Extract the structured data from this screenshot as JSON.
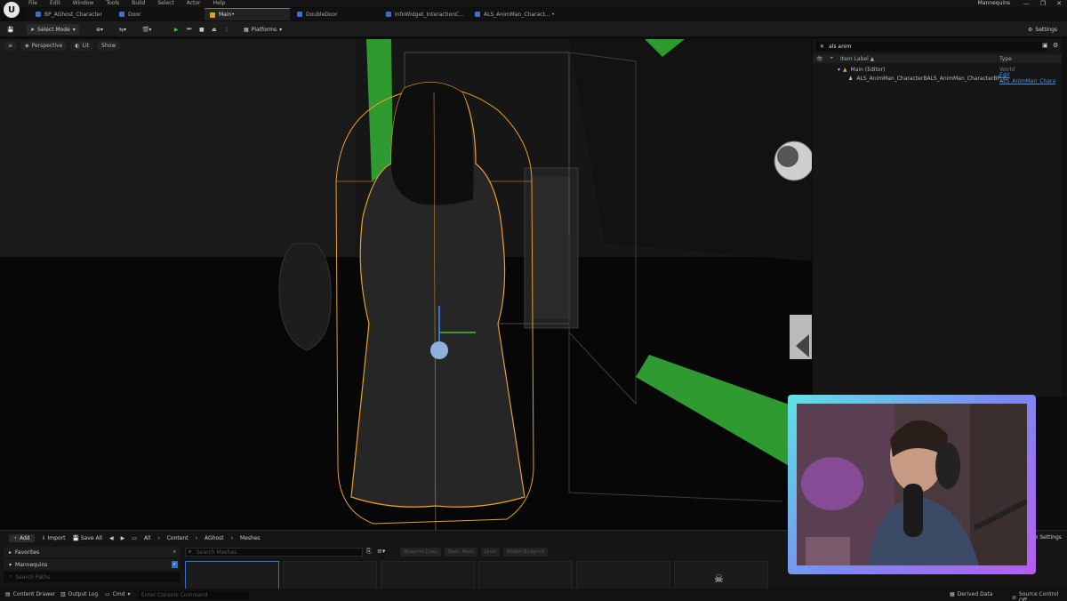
{
  "menu": {
    "items": [
      "File",
      "Edit",
      "Window",
      "Tools",
      "Build",
      "Select",
      "Actor",
      "Help"
    ],
    "project": "Mannequins"
  },
  "tabs": [
    {
      "label": "BP_AGhost_Character"
    },
    {
      "label": "Door"
    },
    {
      "label": "Main•"
    },
    {
      "label": "DoubleDoor"
    },
    {
      "label": "InfoWidget_InteractionC..."
    },
    {
      "label": "ALS_AnimMan_Charact... •"
    }
  ],
  "toolbar": {
    "select_mode": "Select Mode",
    "platforms": "Platforms",
    "settings": "Settings"
  },
  "viewport": {
    "perspective": "Perspective",
    "lit": "Lit",
    "show": "Show"
  },
  "outliner": {
    "search_value": "als anim",
    "col_label": "Item Label ▲",
    "col_type": "Type",
    "rows": [
      {
        "label": "Main (Editor)",
        "type": "World"
      },
      {
        "label": "ALS_AnimMan_CharacterBALS_AnimMan_CharacterBP_C",
        "type": "Edit ALS_AnimMan_Chara"
      }
    ]
  },
  "content_browser": {
    "add": "Add",
    "import": "Import",
    "save_all": "Save All",
    "breadcrumb": [
      "All",
      "Content",
      "AGhost",
      "Meshes"
    ],
    "settings": "Settings",
    "favorites": "Favorites",
    "mannequins": "Mannequins",
    "search_paths_placeholder": "Search Paths",
    "search_meshes_placeholder": "Search Meshes",
    "filters": [
      "Blueprint Class",
      "Static Mesh",
      "Level",
      "Widget Blueprint"
    ]
  },
  "statusbar": {
    "content_drawer": "Content Drawer",
    "output_log": "Output Log",
    "cmd": "Cmd",
    "console_placeholder": "Enter Console Command",
    "derived_data": "Derived Data",
    "source_control": "Source Control Off"
  },
  "colors": {
    "accent_green": "#2f9a2f",
    "selection_orange": "#e8a020",
    "webcam_border_start": "#5fe3e6",
    "webcam_border_end": "#b75cf0"
  }
}
